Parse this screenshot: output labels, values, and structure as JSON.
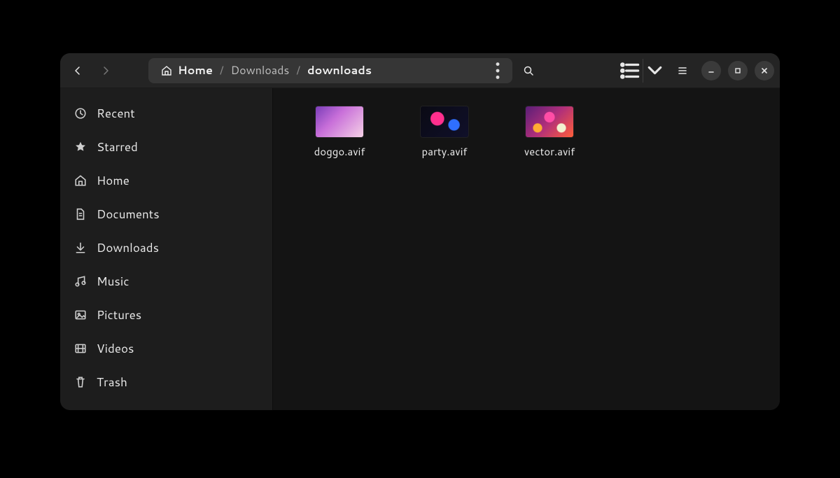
{
  "breadcrumb": {
    "segments": [
      {
        "label": "Home",
        "icon": "home"
      },
      {
        "label": "Downloads",
        "icon": null
      },
      {
        "label": "downloads",
        "icon": null
      }
    ]
  },
  "sidebar": {
    "items": [
      {
        "label": "Recent",
        "icon": "clock"
      },
      {
        "label": "Starred",
        "icon": "star"
      },
      {
        "label": "Home",
        "icon": "home"
      },
      {
        "label": "Documents",
        "icon": "document"
      },
      {
        "label": "Downloads",
        "icon": "download"
      },
      {
        "label": "Music",
        "icon": "music"
      },
      {
        "label": "Pictures",
        "icon": "picture"
      },
      {
        "label": "Videos",
        "icon": "video"
      },
      {
        "label": "Trash",
        "icon": "trash"
      }
    ]
  },
  "files": [
    {
      "name": "doggo.avif",
      "thumb": "t0"
    },
    {
      "name": "party.avif",
      "thumb": "t1"
    },
    {
      "name": "vector.avif",
      "thumb": "t2"
    }
  ]
}
